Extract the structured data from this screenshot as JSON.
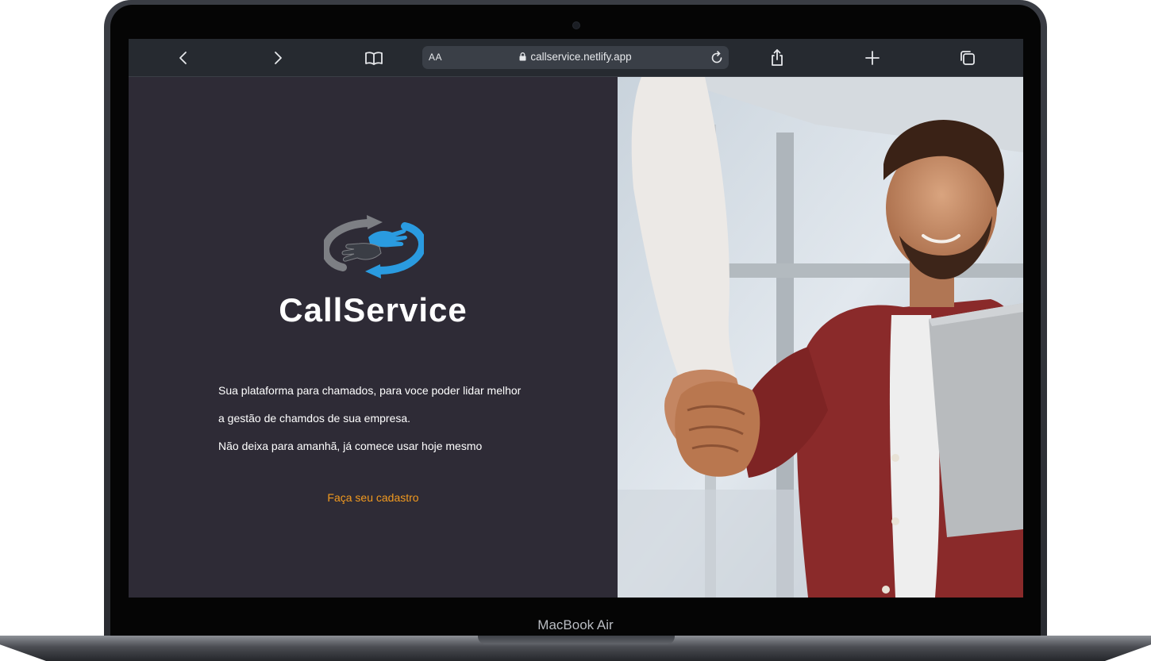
{
  "device": {
    "label": "MacBook Air"
  },
  "browser": {
    "text_size_label": "AA",
    "url": "callservice.netlify.app",
    "icons": {
      "back": "chevron-left-icon",
      "forward": "chevron-right-icon",
      "bookmarks": "book-icon",
      "lock": "lock-icon",
      "reload": "reload-icon",
      "share": "share-icon",
      "new_tab": "plus-icon",
      "tabs": "tabs-icon"
    }
  },
  "page": {
    "brand_name": "CallService",
    "description_lines": [
      "Sua plataforma para chamados, para voce poder lidar melhor",
      "a gestão de chamdos de sua empresa.",
      "Não deixa para amanhã, já comece usar hoje mesmo"
    ],
    "cta_label": "Faça seu cadastro",
    "colors": {
      "background": "#2e2b36",
      "cta": "#f29a1f",
      "logo_blue": "#2a9be0",
      "logo_gray": "#7d7f84"
    }
  }
}
